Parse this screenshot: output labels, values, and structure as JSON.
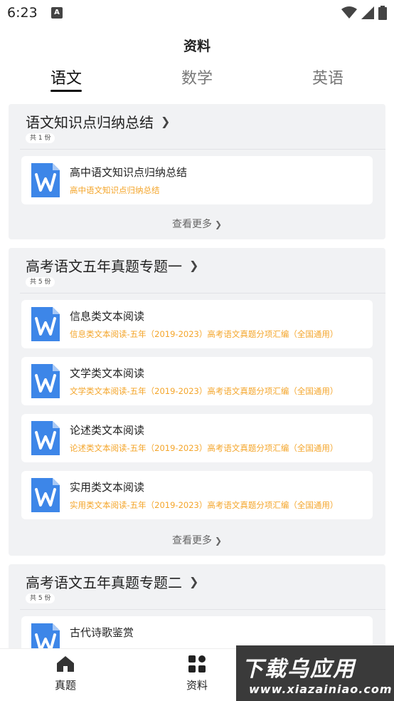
{
  "status_bar": {
    "time": "6:23",
    "notif_icon_letter": "A"
  },
  "app_title": "资料",
  "tabs": [
    {
      "label": "语文",
      "active": true
    },
    {
      "label": "数学",
      "active": false
    },
    {
      "label": "英语",
      "active": false
    }
  ],
  "sections": [
    {
      "title": "语文知识点归纳总结",
      "count": "共 1 份",
      "docs": [
        {
          "title": "高中语文知识点归纳总结",
          "subtitle": "高中语文知识点归纳总结"
        }
      ],
      "see_more": "查看更多"
    },
    {
      "title": "高考语文五年真题专题一",
      "count": "共 5 份",
      "docs": [
        {
          "title": "信息类文本阅读",
          "subtitle": "信息类文本阅读-五年（2019-2023）高考语文真题分项汇编（全国通用）"
        },
        {
          "title": "文学类文本阅读",
          "subtitle": "文学类文本阅读-五年（2019-2023）高考语文真题分项汇编（全国通用）"
        },
        {
          "title": "论述类文本阅读",
          "subtitle": "论述类文本阅读-五年（2019-2023）高考语文真题分项汇编（全国通用）"
        },
        {
          "title": "实用类文本阅读",
          "subtitle": "实用类文本阅读-五年（2019-2023）高考语文真题分项汇编（全国通用）"
        }
      ],
      "see_more": "查看更多"
    },
    {
      "title": "高考语文五年真题专题二",
      "count": "共 5 份",
      "docs": [
        {
          "title": "古代诗歌鉴赏",
          "subtitle": ""
        }
      ]
    }
  ],
  "bottom_nav": [
    {
      "label": "真题",
      "icon": "home-icon"
    },
    {
      "label": "资料",
      "icon": "grid-icon"
    }
  ],
  "watermark": {
    "main": "下载乌应用",
    "sub": "www.xiazainiao.com"
  },
  "colors": {
    "accent_orange": "#f4a52a",
    "doc_icon_blue": "#3d86e8",
    "section_bg": "#f1f2f4"
  }
}
